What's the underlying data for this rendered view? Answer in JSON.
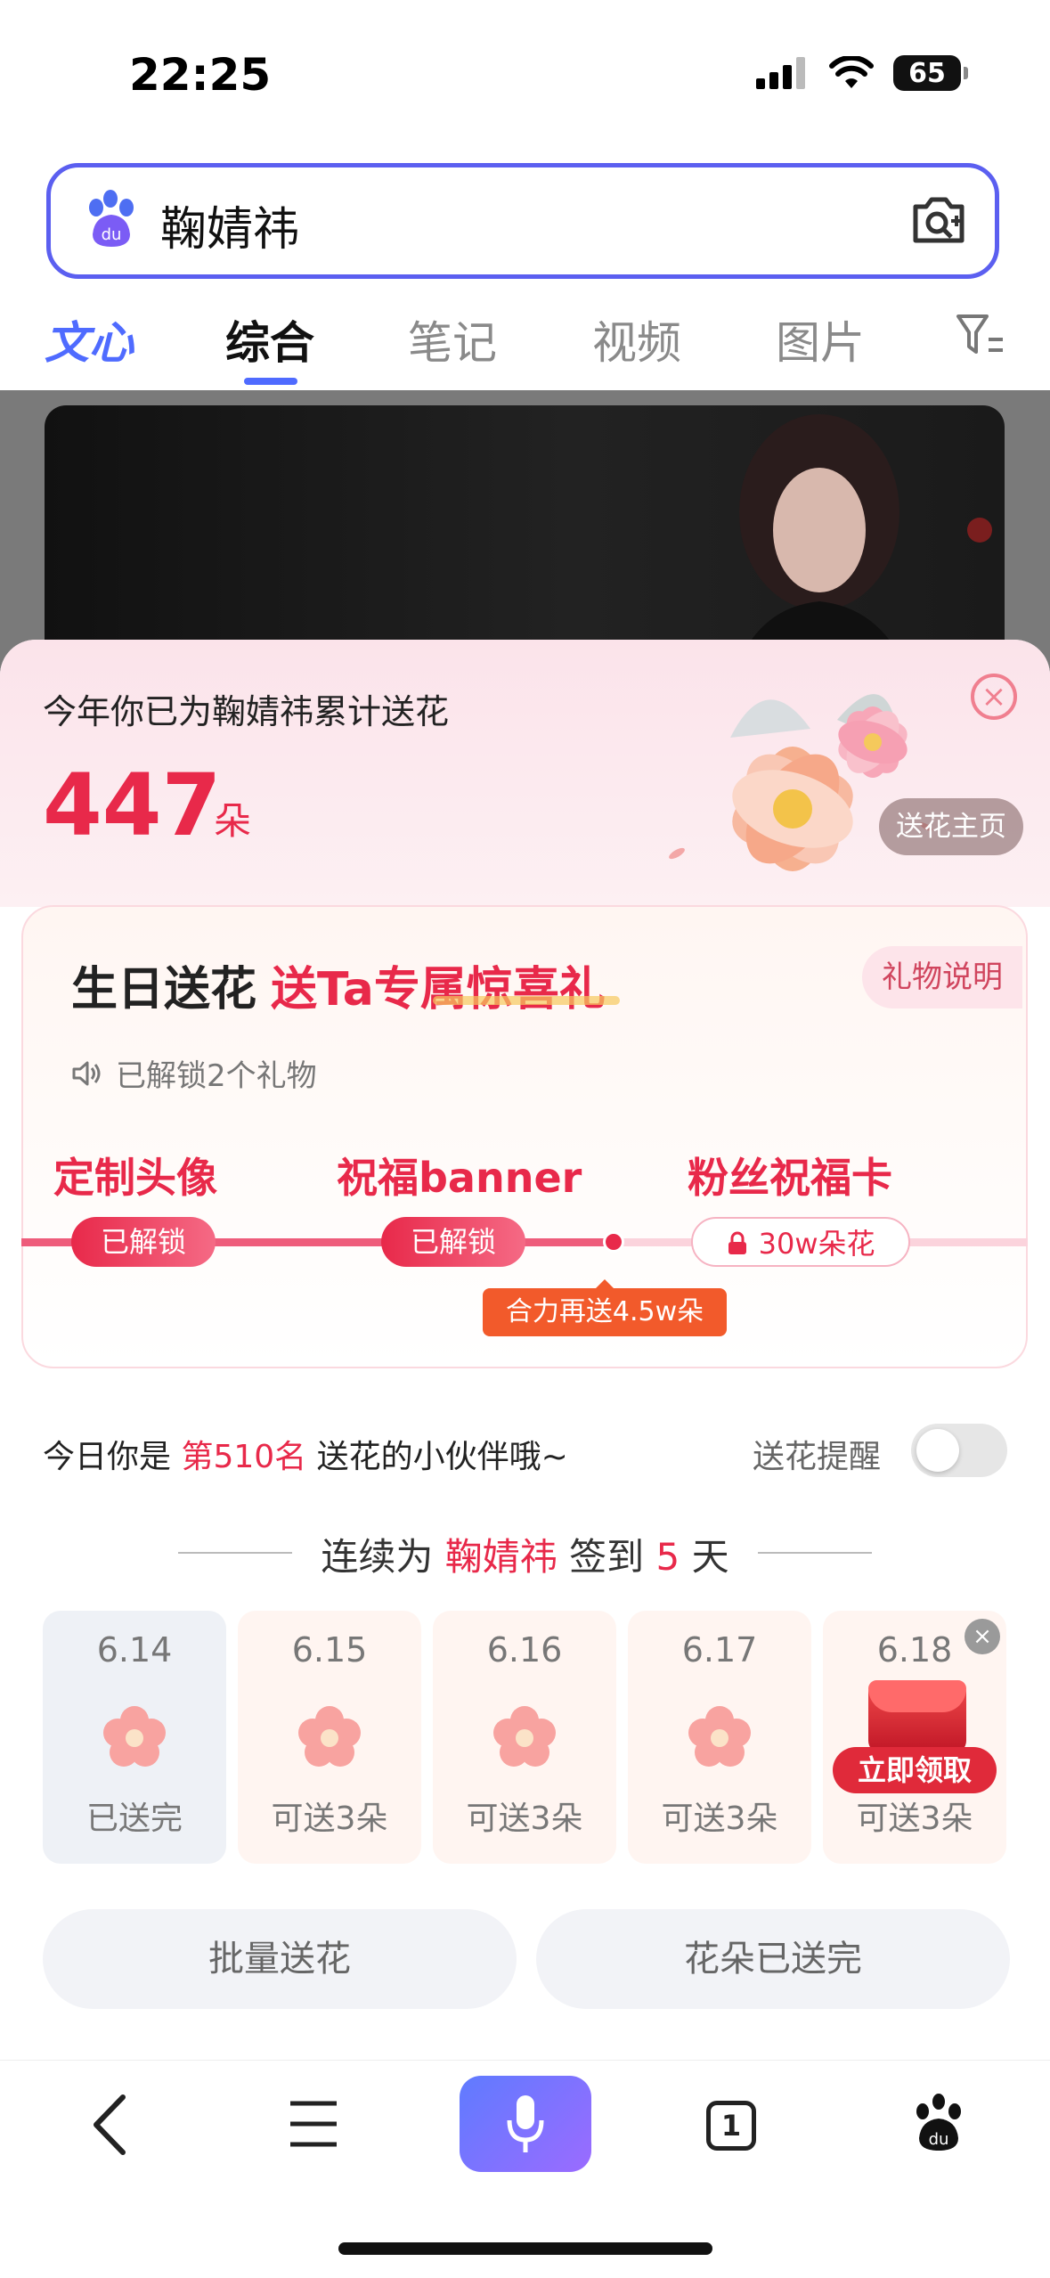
{
  "status": {
    "time": "22:25",
    "battery": "65"
  },
  "search": {
    "query": "鞠婧祎"
  },
  "tabs": [
    {
      "label": "文心"
    },
    {
      "label": "综合"
    },
    {
      "label": "笔记"
    },
    {
      "label": "视频"
    },
    {
      "label": "图片"
    }
  ],
  "sheet": {
    "title": "今年你已为鞠婧祎累计送花",
    "count": "447",
    "count_unit": "朵",
    "close": "×",
    "home_button": "送花主页"
  },
  "gift": {
    "title_main": "生日送花",
    "title_accent": "送Ta专属惊喜礼",
    "explain": "礼物说明",
    "unlocked_text": "已解锁2个礼物",
    "items": [
      {
        "name": "定制头像",
        "badge": "已解锁"
      },
      {
        "name": "祝福banner",
        "badge": "已解锁"
      },
      {
        "name": "粉丝祝福卡",
        "badge": "30w朵花"
      }
    ],
    "more_needed": "合力再送4.5w朵"
  },
  "rank": {
    "prefix": "今日你是",
    "rank": "第510名",
    "suffix": "送花的小伙伴哦~",
    "remind_label": "送花提醒",
    "remind_on": false
  },
  "streak": {
    "prefix": "连续为",
    "name": "鞠婧祎",
    "middle": "签到",
    "days": "5",
    "unit": "天"
  },
  "days": [
    {
      "date": "6.14",
      "status": "已送完"
    },
    {
      "date": "6.15",
      "status": "可送3朵"
    },
    {
      "date": "6.16",
      "status": "可送3朵"
    },
    {
      "date": "6.17",
      "status": "可送3朵"
    },
    {
      "date": "6.18",
      "status": "可送3朵"
    }
  ],
  "claim_label": "立即领取",
  "buttons": {
    "batch": "批量送花",
    "done": "花朵已送完"
  },
  "nav": {
    "tab_count": "1"
  },
  "colors": {
    "accent": "#e8294a",
    "brand": "#4f6bff"
  }
}
